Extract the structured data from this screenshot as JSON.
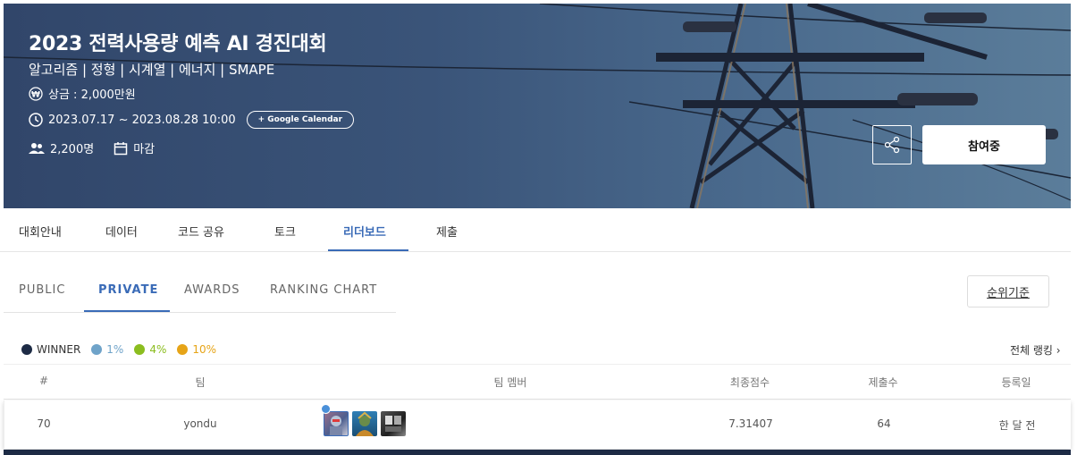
{
  "banner": {
    "title": "2023 전력사용량 예측 AI 경진대회",
    "tags": "알고리즘 | 정형 | 시계열 | 에너지 | SMAPE",
    "prize": "상금 : 2,000만원",
    "period": "2023.07.17 ~ 2023.08.28 10:00",
    "calendar_button": "+ Google Calendar",
    "participants": "2,200명",
    "status": "마감",
    "join_button": "참여중"
  },
  "main_tabs": [
    "대회안내",
    "데이터",
    "코드 공유",
    "토크",
    "리더보드",
    "제출"
  ],
  "sub_tabs": [
    "PUBLIC",
    "PRIVATE",
    "AWARDS",
    "RANKING CHART"
  ],
  "rank_criteria": "순위기준",
  "legend": [
    {
      "label": "WINNER",
      "color": "#1d2b45"
    },
    {
      "label": "1%",
      "color": "#6fa3c9"
    },
    {
      "label": "4%",
      "color": "#8bbd1f"
    },
    {
      "label": "10%",
      "color": "#e6a417"
    }
  ],
  "full_rank_link": "전체 랭킹 ›",
  "table": {
    "columns": [
      "#",
      "팀",
      "팀 멤버",
      "최종점수",
      "제출수",
      "등록일"
    ],
    "rows": [
      {
        "rank": "70",
        "team": "yondu",
        "score": "7.31407",
        "submissions": "64",
        "date": "한 달 전"
      }
    ]
  },
  "colors": {
    "accent": "#3a6bb7",
    "banner": "#3a5479"
  }
}
